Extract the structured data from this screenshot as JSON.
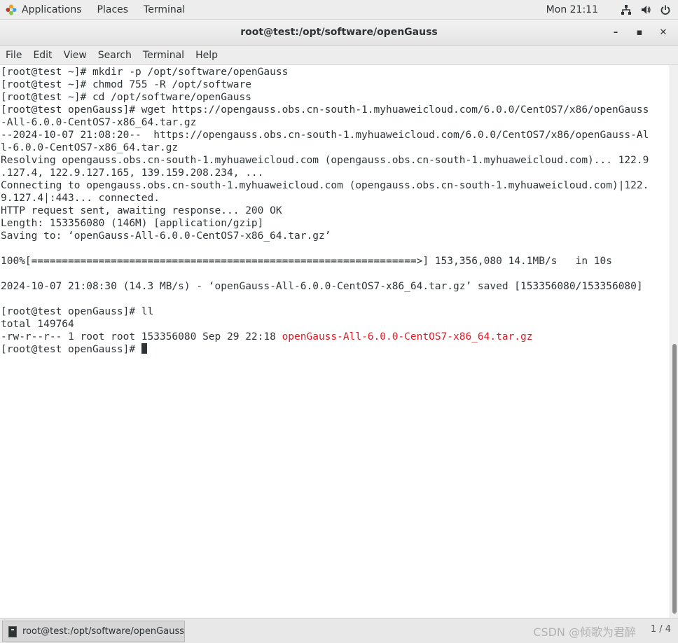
{
  "topbar": {
    "applications": "Applications",
    "places": "Places",
    "terminal": "Terminal",
    "clock": "Mon 21:11",
    "tray_icons": [
      "network-icon",
      "volume-icon",
      "power-icon"
    ]
  },
  "window": {
    "title": "root@test:/opt/software/openGauss",
    "buttons": {
      "minimize": "–",
      "maximize": "▪",
      "close": "✕"
    }
  },
  "menubar": {
    "items": [
      "File",
      "Edit",
      "View",
      "Search",
      "Terminal",
      "Help"
    ]
  },
  "terminal": {
    "lines": [
      "[root@test ~]# mkdir -p /opt/software/openGauss",
      "[root@test ~]# chmod 755 -R /opt/software",
      "[root@test ~]# cd /opt/software/openGauss",
      "[root@test openGauss]# wget https://opengauss.obs.cn-south-1.myhuaweicloud.com/6.0.0/CentOS7/x86/openGauss",
      "-All-6.0.0-CentOS7-x86_64.tar.gz",
      "--2024-10-07 21:08:20--  https://opengauss.obs.cn-south-1.myhuaweicloud.com/6.0.0/CentOS7/x86/openGauss-Al",
      "l-6.0.0-CentOS7-x86_64.tar.gz",
      "Resolving opengauss.obs.cn-south-1.myhuaweicloud.com (opengauss.obs.cn-south-1.myhuaweicloud.com)... 122.9",
      ".127.4, 122.9.127.165, 139.159.208.234, ...",
      "Connecting to opengauss.obs.cn-south-1.myhuaweicloud.com (opengauss.obs.cn-south-1.myhuaweicloud.com)|122.",
      "9.127.4|:443... connected.",
      "HTTP request sent, awaiting response... 200 OK",
      "Length: 153356080 (146M) [application/gzip]",
      "Saving to: ‘openGauss-All-6.0.0-CentOS7-x86_64.tar.gz’",
      "",
      "100%[===============================================================>] 153,356,080 14.1MB/s   in 10s",
      "",
      "2024-10-07 21:08:30 (14.3 MB/s) - ‘openGauss-All-6.0.0-CentOS7-x86_64.tar.gz’ saved [153356080/153356080]",
      "",
      "[root@test openGauss]# ll",
      "total 149764"
    ],
    "ll_row_prefix": "-rw-r--r-- 1 root root 153356080 Sep 29 22:18 ",
    "ll_row_filename": "openGauss-All-6.0.0-CentOS7-x86_64.tar.gz",
    "prompt": "[root@test openGauss]# ",
    "filename_color": "#e01b24"
  },
  "taskbar": {
    "task_label": "root@test:/opt/software/openGauss",
    "workspace": "1 / 4",
    "watermark": "CSDN @倾歌为君醉"
  }
}
